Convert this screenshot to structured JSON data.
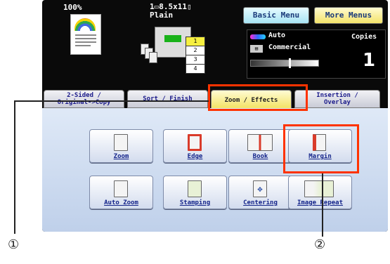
{
  "status": {
    "zoom_percent": "100%",
    "paper_size": "1▭8.5x11▯",
    "paper_type": "Plain",
    "color_mode": "Auto",
    "original_type": "Commercial",
    "copies_label": "Copies",
    "copies_value": "1",
    "tray_numbers": [
      "1",
      "2",
      "3",
      "4"
    ]
  },
  "menu": {
    "basic_label": "Basic Menu",
    "more_label": "More Menus"
  },
  "tabs": [
    {
      "label": "2-Sided /\nOriginal->Copy"
    },
    {
      "label": "Sort / Finish"
    },
    {
      "label": "Zoom / Effects"
    },
    {
      "label": "Insertion /\nOverlay"
    }
  ],
  "functions": [
    {
      "label": "Zoom",
      "icon": "zoom-icon"
    },
    {
      "label": "Edge",
      "icon": "edge-icon"
    },
    {
      "label": "Book",
      "icon": "book-icon"
    },
    {
      "label": "Margin",
      "icon": "margin-icon"
    },
    {
      "label": "Auto Zoom",
      "icon": "auto-zoom-icon"
    },
    {
      "label": "Stamping",
      "icon": "stamping-icon"
    },
    {
      "label": "Centering",
      "icon": "centering-icon"
    },
    {
      "label": "Image Repeat",
      "icon": "image-repeat-icon"
    }
  ],
  "callouts": [
    "①",
    "②"
  ],
  "colors": {
    "highlight": "#ff3300",
    "active_tab": "#f2e15c"
  }
}
